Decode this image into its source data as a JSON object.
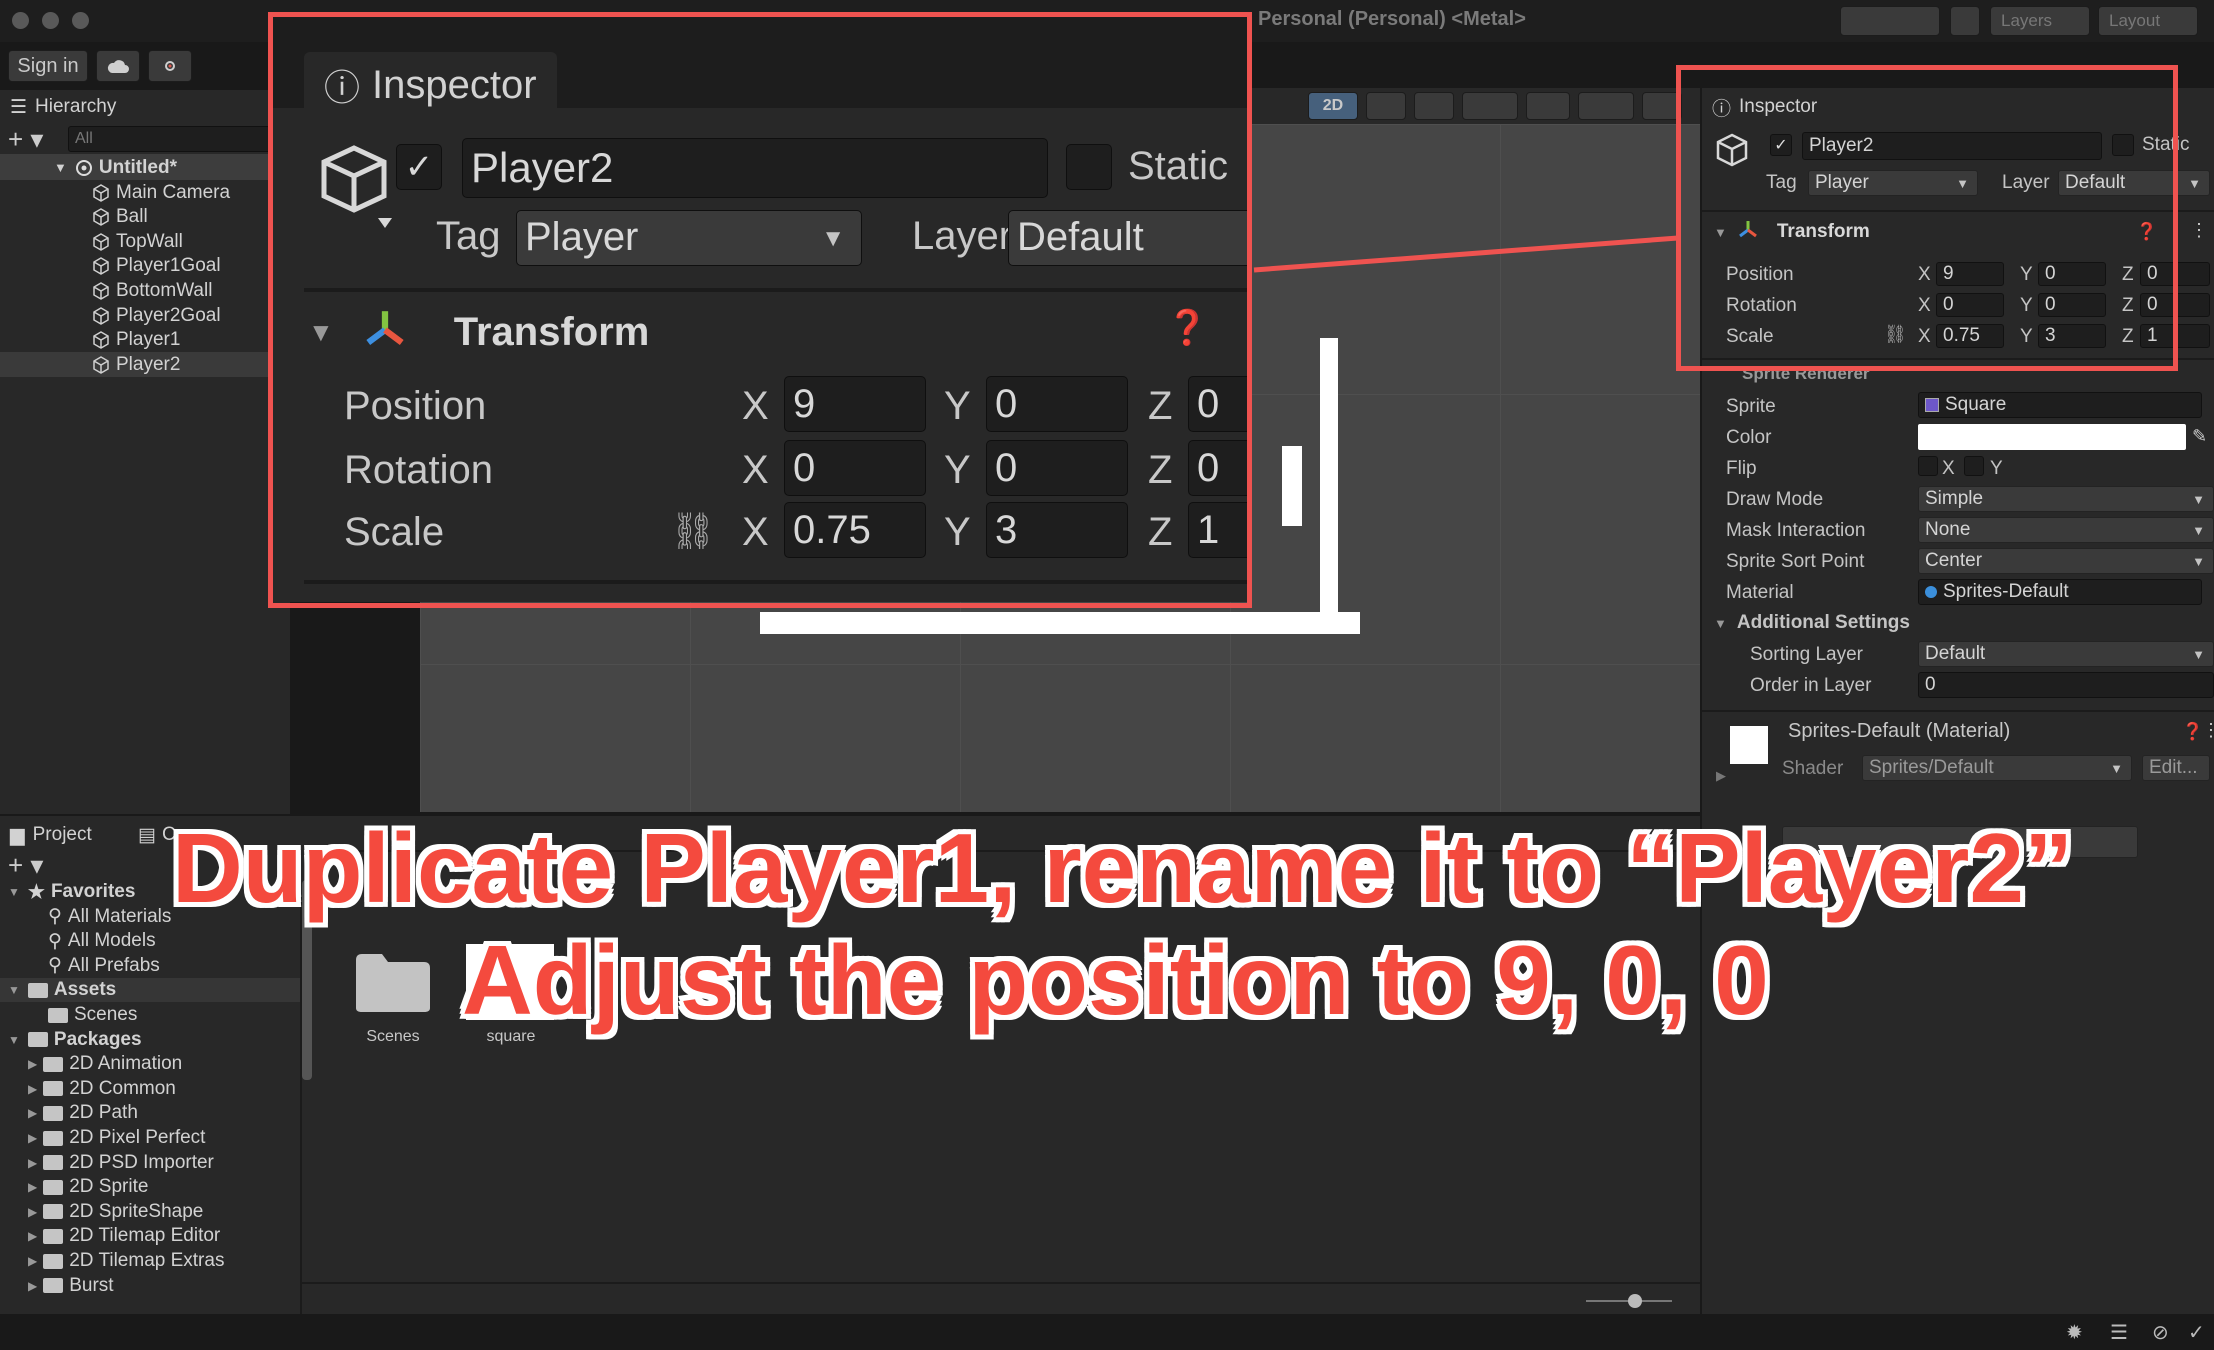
{
  "window": {
    "title": "Personal (Personal) <Metal>"
  },
  "toolbar": {
    "sign_in": "Sign in",
    "layers_label": "Layers",
    "layout_label": "Layout"
  },
  "hierarchy": {
    "tab": "Hierarchy",
    "search_placeholder": "All",
    "scene": "Untitled*",
    "items": [
      "Main Camera",
      "Ball",
      "TopWall",
      "Player1Goal",
      "BottomWall",
      "Player2Goal",
      "Player1",
      "Player2"
    ]
  },
  "scene_toolbar": {
    "mode_2d": "2D"
  },
  "inspector": {
    "tab": "Inspector",
    "name": "Player2",
    "static_label": "Static",
    "tag_label": "Tag",
    "tag_value": "Player",
    "layer_label": "Layer",
    "layer_value": "Default",
    "transform": {
      "title": "Transform",
      "position_label": "Position",
      "rotation_label": "Rotation",
      "scale_label": "Scale",
      "position": {
        "x": "9",
        "y": "0",
        "z": "0"
      },
      "rotation": {
        "x": "0",
        "y": "0",
        "z": "0"
      },
      "scale": {
        "x": "0.75",
        "y": "3",
        "z": "1"
      }
    },
    "sprite_renderer": {
      "title": "Sprite Renderer",
      "sprite_label": "Sprite",
      "sprite_value": "Square",
      "color_label": "Color",
      "flip_label": "Flip",
      "flip_x": "X",
      "flip_y": "Y",
      "draw_mode_label": "Draw Mode",
      "draw_mode_value": "Simple",
      "mask_label": "Mask Interaction",
      "mask_value": "None",
      "sort_point_label": "Sprite Sort Point",
      "sort_point_value": "Center",
      "material_label": "Material",
      "material_value": "Sprites-Default",
      "additional_settings": "Additional Settings",
      "sorting_layer_label": "Sorting Layer",
      "sorting_layer_value": "Default",
      "order_label": "Order in Layer",
      "order_value": "0"
    },
    "material": {
      "title": "Sprites-Default (Material)",
      "shader_label": "Shader",
      "shader_value": "Sprites/Default",
      "edit_label": "Edit..."
    }
  },
  "project": {
    "tab": "Project",
    "tab2": "C",
    "favorites_label": "Favorites",
    "favorites": [
      "All Materials",
      "All Models",
      "All Prefabs"
    ],
    "assets_label": "Assets",
    "assets": [
      "Scenes"
    ],
    "packages_label": "Packages",
    "packages": [
      "2D Animation",
      "2D Common",
      "2D Path",
      "2D Pixel Perfect",
      "2D PSD Importer",
      "2D Sprite",
      "2D SpriteShape",
      "2D Tilemap Editor",
      "2D Tilemap Extras",
      "Burst"
    ],
    "grid_items": [
      "Scenes",
      "square"
    ]
  },
  "caption": {
    "line1": "Duplicate Player1, rename it to “Player2”",
    "line2": "Adjust the position to 9, 0, 0"
  },
  "colors": {
    "highlight": "#ef5350",
    "caption": "#f44a3e",
    "panel": "#282828",
    "field": "#1e1e1e"
  }
}
